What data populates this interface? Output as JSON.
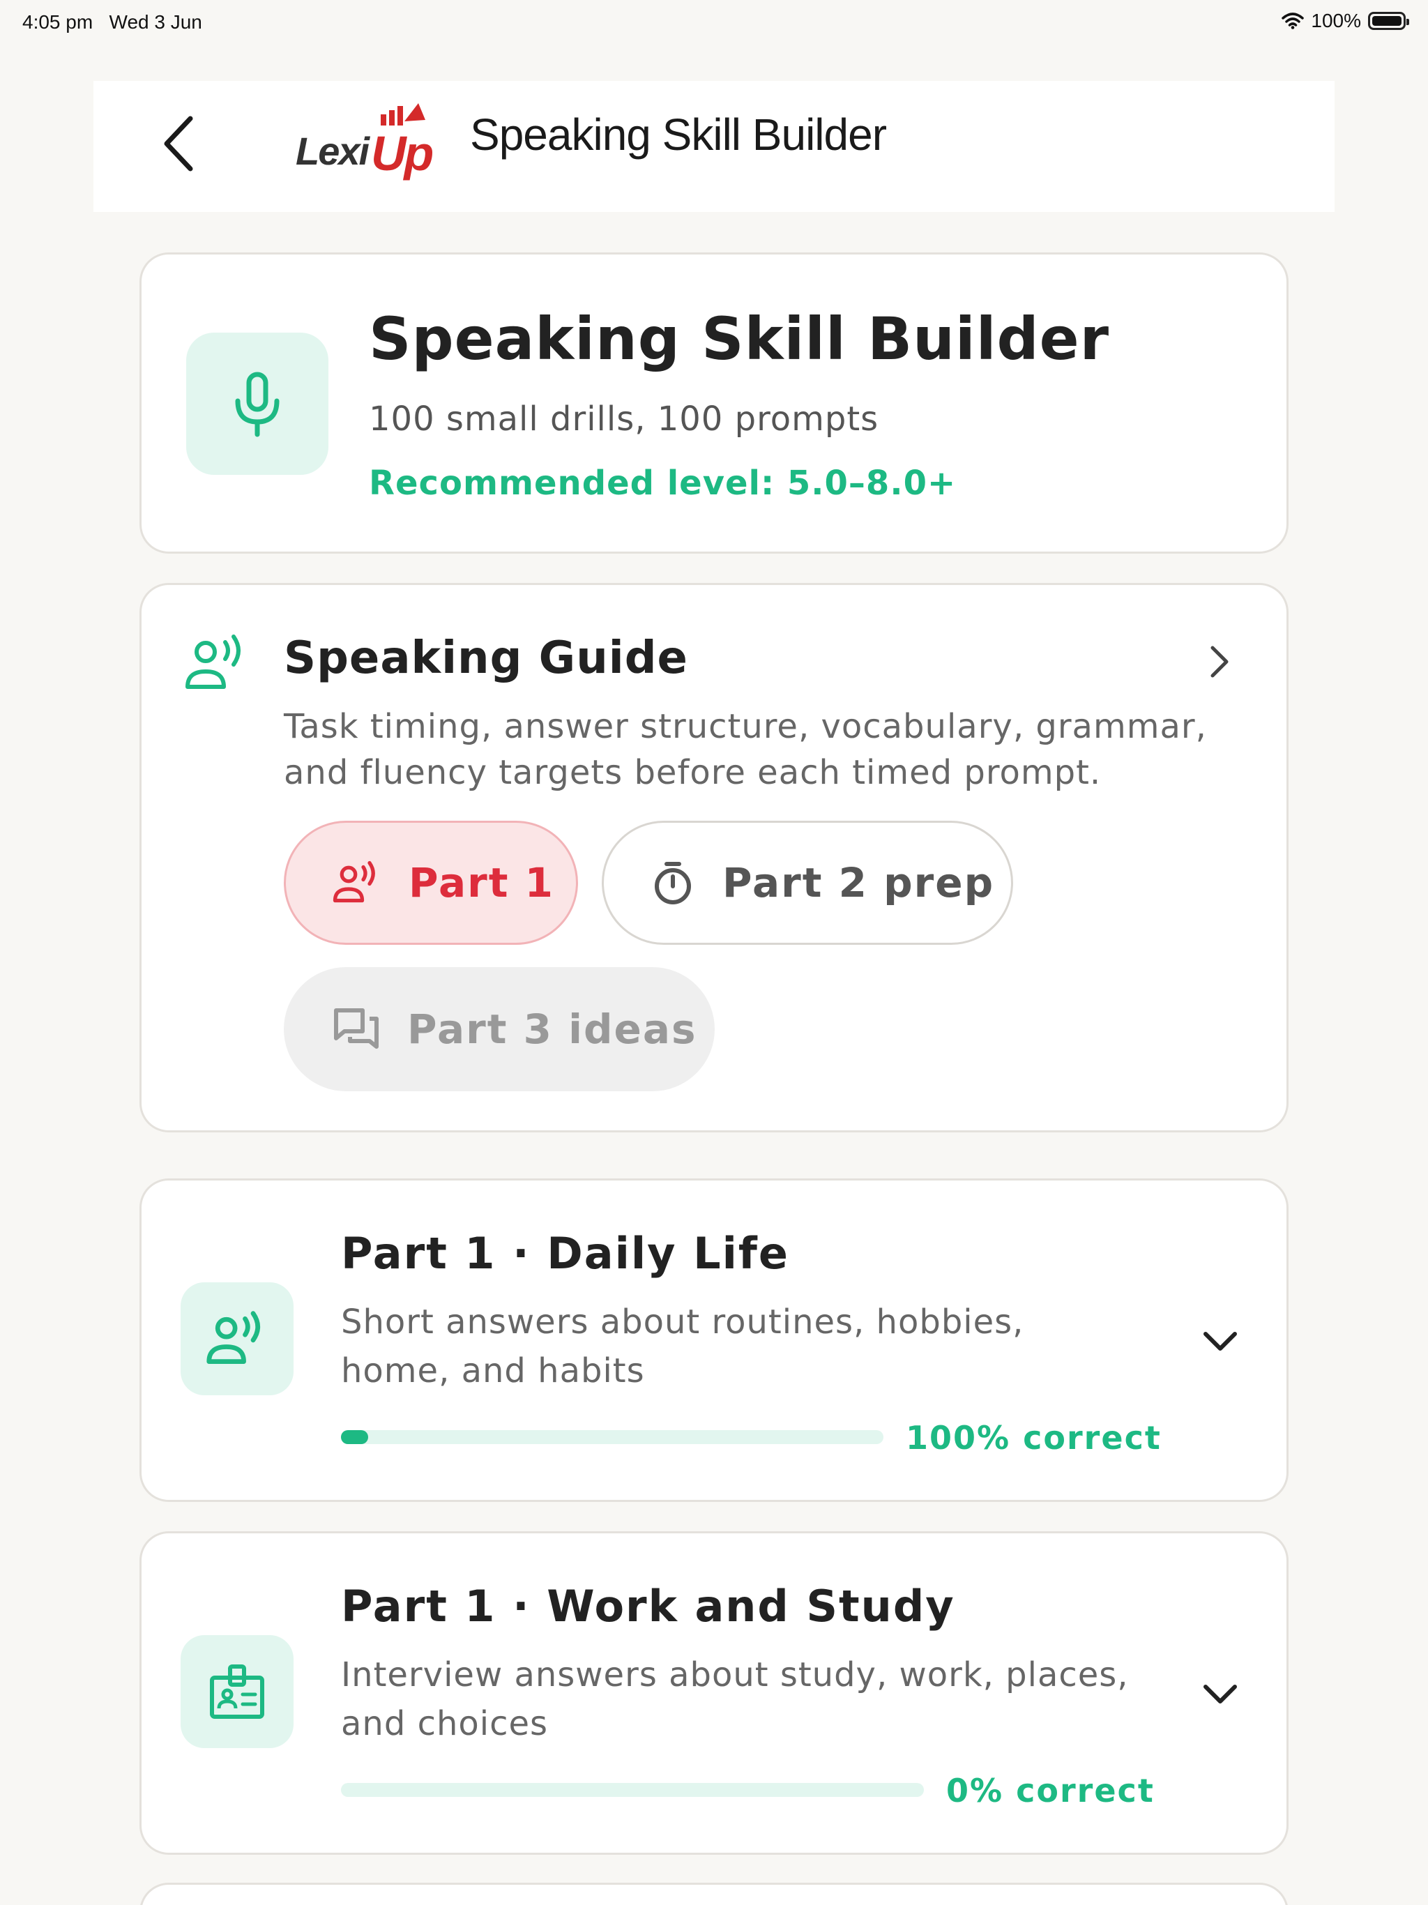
{
  "status_bar": {
    "time": "4:05 pm",
    "date": "Wed 3 Jun",
    "battery": "100%"
  },
  "header": {
    "back_icon": "chevron-left-icon",
    "logo_text_1": "Lexi",
    "logo_text_2": "Up",
    "title": "Speaking Skill Builder"
  },
  "hero": {
    "icon": "microphone-icon",
    "title": "Speaking Skill Builder",
    "subtitle": "100 small drills, 100 prompts",
    "level": "Recommended level: 5.0–8.0+"
  },
  "guide": {
    "icon": "person-speaking-icon",
    "title": "Speaking Guide",
    "description": "Task timing, answer structure, vocabulary, grammar, and fluency targets before each timed prompt.",
    "chips": [
      {
        "label": "Part 1",
        "icon": "person-speaking-icon",
        "state": "selected"
      },
      {
        "label": "Part 2 prep",
        "icon": "timer-icon",
        "state": "default"
      },
      {
        "label": "Part 3 ideas",
        "icon": "chat-bubbles-icon",
        "state": "disabled"
      }
    ]
  },
  "lessons": [
    {
      "icon": "person-speaking-icon",
      "title": "Part 1 · Daily Life",
      "description": "Short answers about routines, hobbies, home, and habits",
      "progress": 0.05,
      "progress_label": "100% correct"
    },
    {
      "icon": "id-badge-icon",
      "title": "Part 1 · Work and Study",
      "description": "Interview answers about study, work, places, and choices",
      "progress": 0,
      "progress_label": "0% correct"
    }
  ],
  "colors": {
    "accent_green": "#1db983",
    "accent_red": "#dd2d3c",
    "icon_bg": "#e2f6ef",
    "page_bg": "#f8f7f4"
  }
}
